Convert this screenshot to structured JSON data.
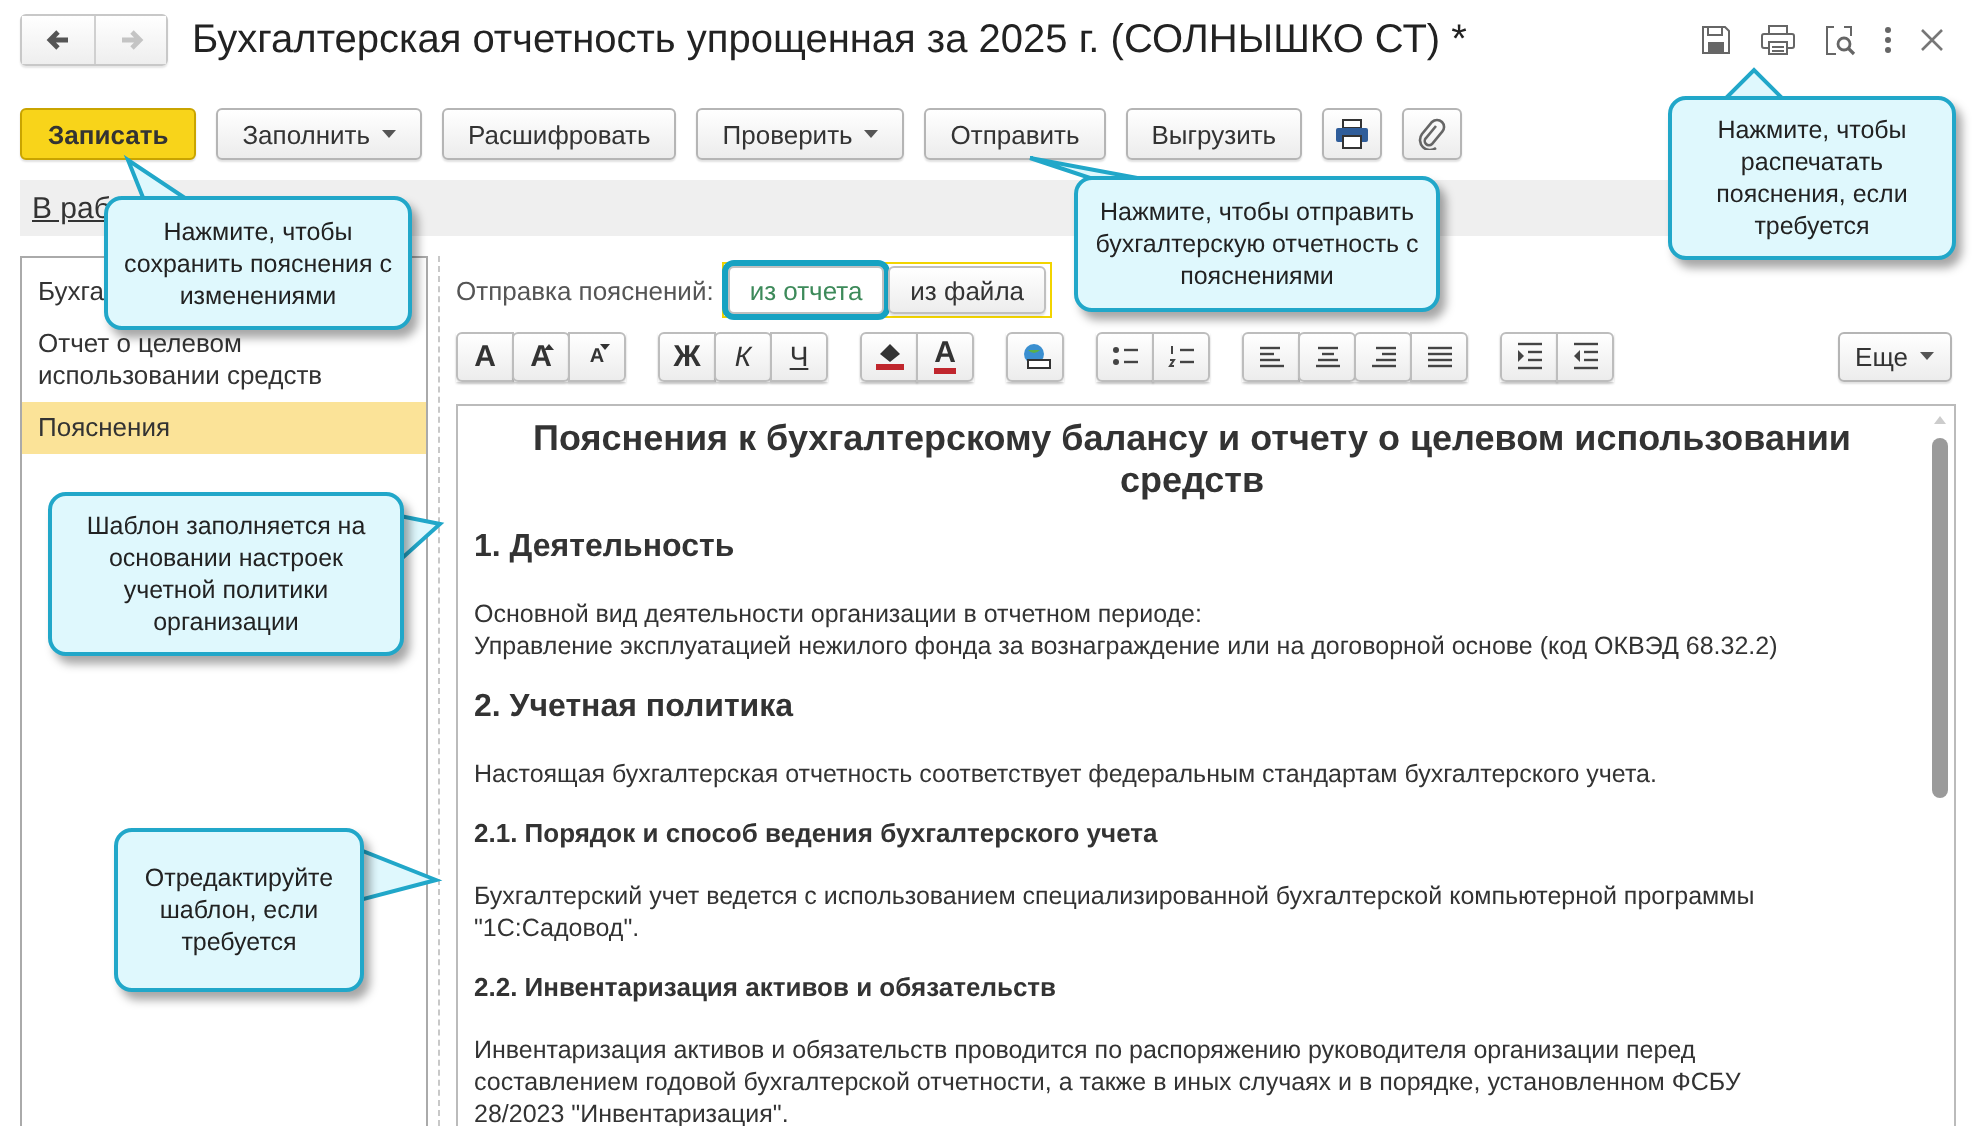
{
  "window": {
    "title": "Бухгалтерская отчетность упрощенная за 2025 г. (СОЛНЫШКО СТ) *"
  },
  "nav": [
    {
      "kind": "back",
      "disabled": false
    },
    {
      "kind": "forward",
      "disabled": true
    }
  ],
  "toolbar": [
    {
      "label": "Записать",
      "kind": "primary"
    },
    {
      "label": "Заполнить",
      "kind": "menu"
    },
    {
      "label": "Расшифровать",
      "kind": "plain"
    },
    {
      "label": "Проверить",
      "kind": "menu"
    },
    {
      "label": "Отправить",
      "kind": "plain"
    },
    {
      "label": "Выгрузить",
      "kind": "plain"
    }
  ],
  "status_link": "В раб",
  "sections": [
    {
      "label": "Бухга",
      "selected": false
    },
    {
      "label": "Отчет о целевом использовании средств",
      "selected": false
    },
    {
      "label": "Пояснения",
      "selected": true
    }
  ],
  "send_mode": {
    "label": "Отправка пояснений:",
    "options": [
      {
        "label": "из отчета",
        "selected": true
      },
      {
        "label": "из файла",
        "selected": false
      }
    ]
  },
  "format_groups": [
    [
      {
        "kind": "font",
        "label": "А"
      },
      {
        "kind": "grow",
        "label": "А"
      },
      {
        "kind": "shrink",
        "label": "А"
      }
    ],
    [
      {
        "kind": "bold",
        "label": "Ж"
      },
      {
        "kind": "italic",
        "label": "К"
      },
      {
        "kind": "underline",
        "label": "Ч"
      }
    ],
    [
      {
        "kind": "fill"
      },
      {
        "kind": "color",
        "label": "А"
      }
    ],
    [
      {
        "kind": "image"
      }
    ],
    [
      {
        "kind": "bullets"
      },
      {
        "kind": "numbers"
      }
    ],
    [
      {
        "kind": "align-left"
      },
      {
        "kind": "align-center"
      },
      {
        "kind": "align-right"
      },
      {
        "kind": "justify"
      }
    ],
    [
      {
        "kind": "indent"
      },
      {
        "kind": "outdent"
      }
    ]
  ],
  "more_button": "Еще",
  "document": {
    "title": "Пояснения к бухгалтерскому балансу и отчету о целевом использовании средств",
    "blocks": [
      {
        "kind": "h1",
        "text": "1. Деятельность"
      },
      {
        "kind": "p",
        "text": "Основной вид деятельности организации в отчетном периоде:\nУправление эксплуатацией нежилого фонда за вознаграждение или на договорной основе (код ОКВЭД 68.32.2)"
      },
      {
        "kind": "h1",
        "text": "2. Учетная политика"
      },
      {
        "kind": "p",
        "text": "Настоящая бухгалтерская отчетность соответствует федеральным стандартам бухгалтерского учета."
      },
      {
        "kind": "h2",
        "text": "2.1. Порядок и способ ведения бухгалтерского учета"
      },
      {
        "kind": "p",
        "text": "Бухгалтерский учет ведется с использованием специализированной бухгалтерской компьютерной программы\n\"1С:Садовод\"."
      },
      {
        "kind": "h2",
        "text": "2.2. Инвентаризация активов и обязательств"
      },
      {
        "kind": "p",
        "text": "Инвентаризация активов и обязательств проводится по распоряжению руководителя организации перед\nсоставлением годовой бухгалтерской отчетности, а также в иных случаях и в порядке, установленном ФСБУ\n28/2023 \"Инвентаризация\"."
      }
    ]
  },
  "callouts": [
    {
      "text": "Нажмите, чтобы сохранить пояснения с изменениями"
    },
    {
      "text": "Нажмите, чтобы отправить бухгалтерскую отчетность с пояснениями"
    },
    {
      "text": "Нажмите, чтобы распечатать пояснения, если требуется"
    },
    {
      "text": "Шаблон заполняется на основании настроек учетной политики организации"
    },
    {
      "text": "Отредактируйте шаблон, если требуется"
    }
  ]
}
